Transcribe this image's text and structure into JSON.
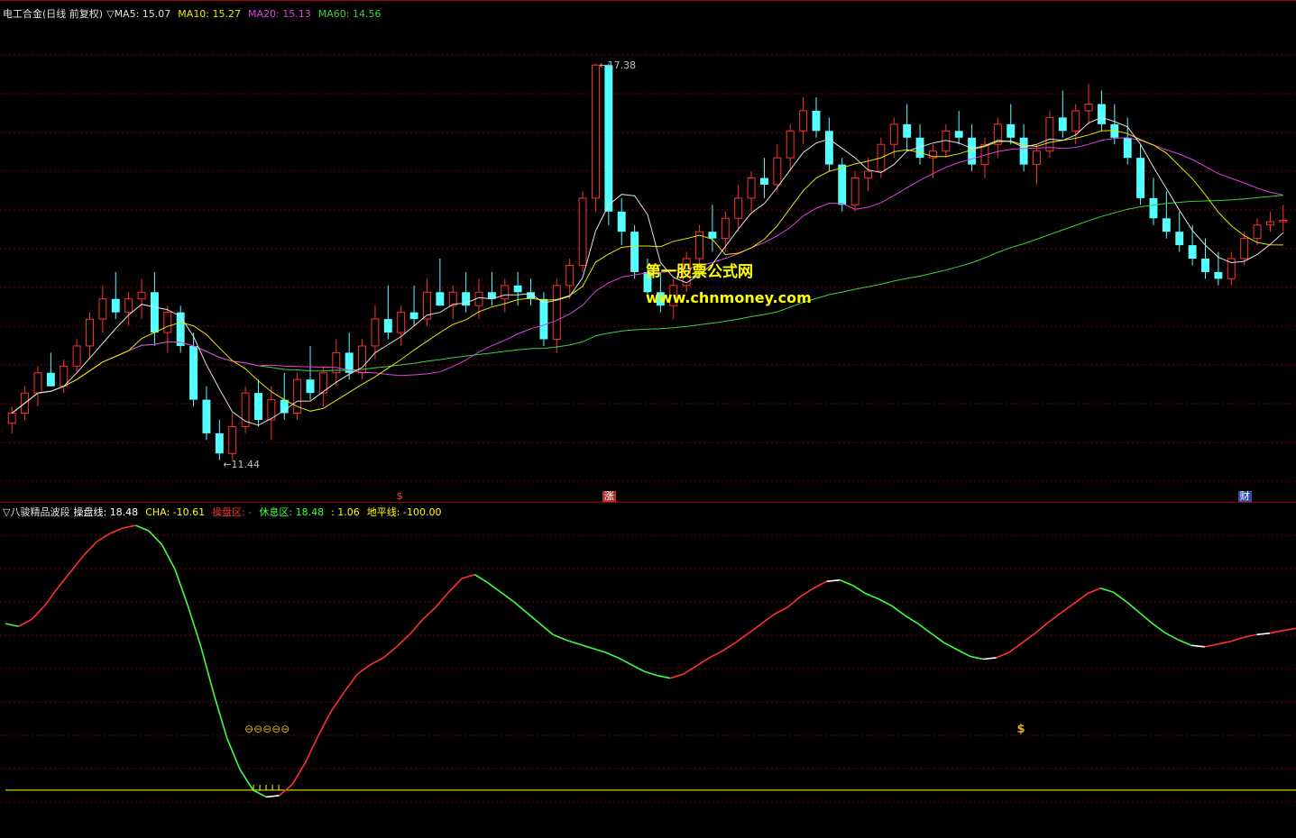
{
  "upper_header": {
    "stock_label": "电工合金(日线 前复权)",
    "indicator_mark": "▽",
    "ma5": {
      "label": "MA5:",
      "value": "15.07",
      "color": "#e0e0e0"
    },
    "ma10": {
      "label": "MA10:",
      "value": "15.27",
      "color": "#e6e600"
    },
    "ma20": {
      "label": "MA20:",
      "value": "15.13",
      "color": "#e040e0"
    },
    "ma60": {
      "label": "MA60:",
      "value": "14.56",
      "color": "#40d040"
    }
  },
  "watermark": {
    "line1": "第一股票公式网",
    "line2": "www.chnmoney.com"
  },
  "price_labels": {
    "high": "17.38",
    "low": "11.44"
  },
  "event_markers": [
    {
      "text": "$",
      "color": "#ff4040",
      "bg": "#000000"
    },
    {
      "text": "涨",
      "color": "#ffffff",
      "bg": "#b03030"
    },
    {
      "text": "财",
      "color": "#ffffff",
      "bg": "#3050b0"
    }
  ],
  "lower_header": {
    "indicator_name": "▽八骏精品波段",
    "line1": {
      "label": "操盘线:",
      "value": "18.48",
      "color": "#ffffff"
    },
    "line2": {
      "label": "CHA:",
      "value": "-10.61",
      "color": "#ffff00"
    },
    "line3": {
      "label": "操盘区:",
      "value": "-",
      "color": "#ff3030"
    },
    "line4": {
      "label": "休息区:",
      "value": "18.48",
      "color": "#40ff40"
    },
    "line5": {
      "label": ":",
      "value": "1.06",
      "color": "#ffff00"
    },
    "line6": {
      "label": "地平线:",
      "value": "-100.00",
      "color": "#ffff00"
    }
  },
  "colors": {
    "up": "#ff3030",
    "down": "#54ffff",
    "ma5": "#e0e0e0",
    "ma10": "#e6e600",
    "ma20": "#e040e0",
    "ma60": "#40d040",
    "grid": "#7a0000",
    "border": "#a00000"
  },
  "chart_data": [
    {
      "type": "candlestick",
      "title": "电工合金(日线 前复权)",
      "ylim": [
        11.0,
        18.0
      ],
      "ohlc": [
        [
          12.05,
          12.3,
          11.9,
          12.2
        ],
        [
          12.2,
          12.6,
          12.1,
          12.5
        ],
        [
          12.5,
          12.9,
          12.3,
          12.8
        ],
        [
          12.8,
          13.1,
          12.6,
          12.6
        ],
        [
          12.6,
          13.0,
          12.5,
          12.9
        ],
        [
          12.9,
          13.3,
          12.8,
          13.2
        ],
        [
          13.2,
          13.7,
          13.0,
          13.6
        ],
        [
          13.6,
          14.1,
          13.4,
          13.9
        ],
        [
          13.9,
          14.3,
          13.6,
          13.7
        ],
        [
          13.7,
          14.0,
          13.5,
          13.9
        ],
        [
          13.9,
          14.2,
          13.6,
          14.0
        ],
        [
          14.0,
          14.3,
          13.2,
          13.4
        ],
        [
          13.4,
          13.8,
          13.1,
          13.7
        ],
        [
          13.7,
          13.8,
          13.1,
          13.2
        ],
        [
          13.2,
          13.4,
          12.3,
          12.4
        ],
        [
          12.4,
          12.6,
          11.8,
          11.9
        ],
        [
          11.9,
          12.1,
          11.5,
          11.6
        ],
        [
          11.6,
          12.2,
          11.5,
          12.0
        ],
        [
          12.0,
          12.6,
          11.9,
          12.5
        ],
        [
          12.5,
          12.7,
          12.0,
          12.1
        ],
        [
          12.1,
          12.6,
          11.8,
          12.4
        ],
        [
          12.4,
          12.8,
          12.1,
          12.2
        ],
        [
          12.2,
          12.8,
          12.1,
          12.7
        ],
        [
          12.7,
          13.2,
          12.4,
          12.5
        ],
        [
          12.5,
          12.9,
          12.3,
          12.8
        ],
        [
          12.8,
          13.3,
          12.6,
          13.1
        ],
        [
          13.1,
          13.4,
          12.7,
          12.8
        ],
        [
          12.8,
          13.3,
          12.7,
          13.2
        ],
        [
          13.2,
          13.8,
          13.0,
          13.6
        ],
        [
          13.6,
          14.1,
          13.3,
          13.4
        ],
        [
          13.4,
          13.8,
          13.2,
          13.7
        ],
        [
          13.7,
          14.1,
          13.5,
          13.6
        ],
        [
          13.6,
          14.2,
          13.5,
          14.0
        ],
        [
          14.0,
          14.5,
          13.8,
          13.8
        ],
        [
          13.8,
          14.1,
          13.6,
          14.0
        ],
        [
          14.0,
          14.3,
          13.7,
          13.8
        ],
        [
          13.8,
          14.2,
          13.6,
          14.0
        ],
        [
          14.0,
          14.3,
          13.8,
          13.9
        ],
        [
          13.9,
          14.2,
          13.7,
          14.1
        ],
        [
          14.1,
          14.3,
          13.8,
          14.0
        ],
        [
          14.0,
          14.2,
          13.8,
          13.9
        ],
        [
          13.9,
          14.0,
          13.2,
          13.3
        ],
        [
          13.3,
          14.2,
          13.1,
          14.1
        ],
        [
          14.1,
          14.5,
          13.9,
          14.4
        ],
        [
          14.4,
          15.5,
          14.3,
          15.4
        ],
        [
          15.4,
          17.4,
          15.2,
          17.38
        ],
        [
          17.38,
          17.4,
          15.0,
          15.2
        ],
        [
          15.2,
          15.4,
          14.7,
          14.9
        ],
        [
          14.9,
          15.0,
          14.2,
          14.3
        ],
        [
          14.3,
          14.5,
          13.9,
          14.0
        ],
        [
          14.0,
          14.3,
          13.7,
          13.8
        ],
        [
          13.8,
          14.2,
          13.6,
          14.1
        ],
        [
          14.1,
          14.6,
          14.0,
          14.5
        ],
        [
          14.5,
          15.0,
          14.3,
          14.9
        ],
        [
          14.9,
          15.3,
          14.6,
          14.8
        ],
        [
          14.8,
          15.2,
          14.6,
          15.1
        ],
        [
          15.1,
          15.6,
          14.9,
          15.4
        ],
        [
          15.4,
          15.8,
          15.2,
          15.7
        ],
        [
          15.7,
          16.0,
          15.4,
          15.6
        ],
        [
          15.6,
          16.2,
          15.5,
          16.0
        ],
        [
          16.0,
          16.5,
          15.8,
          16.4
        ],
        [
          16.4,
          16.9,
          16.2,
          16.7
        ],
        [
          16.7,
          16.9,
          16.3,
          16.4
        ],
        [
          16.4,
          16.6,
          15.8,
          15.9
        ],
        [
          15.9,
          16.0,
          15.2,
          15.3
        ],
        [
          15.3,
          15.8,
          15.2,
          15.7
        ],
        [
          15.7,
          16.0,
          15.5,
          15.8
        ],
        [
          15.8,
          16.3,
          15.7,
          16.2
        ],
        [
          16.2,
          16.6,
          16.0,
          16.5
        ],
        [
          16.5,
          16.8,
          16.1,
          16.3
        ],
        [
          16.3,
          16.5,
          15.9,
          16.0
        ],
        [
          16.0,
          16.2,
          15.7,
          16.1
        ],
        [
          16.1,
          16.5,
          16.0,
          16.4
        ],
        [
          16.4,
          16.7,
          16.2,
          16.3
        ],
        [
          16.3,
          16.5,
          15.8,
          15.9
        ],
        [
          15.9,
          16.3,
          15.7,
          16.2
        ],
        [
          16.2,
          16.6,
          16.0,
          16.5
        ],
        [
          16.5,
          16.8,
          16.2,
          16.3
        ],
        [
          16.3,
          16.5,
          15.8,
          15.9
        ],
        [
          15.9,
          16.2,
          15.6,
          16.1
        ],
        [
          16.1,
          16.7,
          16.0,
          16.6
        ],
        [
          16.6,
          17.0,
          16.3,
          16.4
        ],
        [
          16.4,
          16.8,
          16.2,
          16.7
        ],
        [
          16.7,
          17.1,
          16.5,
          16.8
        ],
        [
          16.8,
          17.0,
          16.4,
          16.5
        ],
        [
          16.5,
          16.8,
          16.2,
          16.3
        ],
        [
          16.3,
          16.6,
          15.9,
          16.0
        ],
        [
          16.0,
          16.2,
          15.3,
          15.4
        ],
        [
          15.4,
          15.7,
          15.0,
          15.1
        ],
        [
          15.1,
          15.5,
          14.8,
          14.9
        ],
        [
          14.9,
          15.2,
          14.6,
          14.7
        ],
        [
          14.7,
          15.0,
          14.4,
          14.5
        ],
        [
          14.5,
          14.8,
          14.2,
          14.3
        ],
        [
          14.3,
          14.6,
          14.1,
          14.2
        ],
        [
          14.2,
          14.6,
          14.1,
          14.5
        ],
        [
          14.5,
          14.9,
          14.4,
          14.8
        ],
        [
          14.8,
          15.1,
          14.7,
          15.0
        ],
        [
          15.0,
          15.2,
          14.9,
          15.05
        ],
        [
          15.05,
          15.3,
          14.9,
          15.07
        ]
      ]
    },
    {
      "type": "line",
      "title": "八骏精品波段",
      "ylim": [
        -110,
        100
      ],
      "horizon": -100.0,
      "values": [
        22,
        20,
        25,
        35,
        48,
        60,
        72,
        82,
        88,
        92,
        94,
        90,
        80,
        62,
        35,
        5,
        -30,
        -62,
        -85,
        -100,
        -105,
        -104,
        -96,
        -80,
        -60,
        -42,
        -28,
        -15,
        -8,
        -3,
        5,
        14,
        25,
        34,
        45,
        55,
        58,
        52,
        45,
        38,
        30,
        22,
        14,
        10,
        7,
        4,
        1,
        -3,
        -8,
        -13,
        -16,
        -18,
        -15,
        -9,
        -3,
        2,
        8,
        15,
        22,
        29,
        34,
        42,
        48,
        53,
        54,
        50,
        44,
        40,
        35,
        28,
        22,
        15,
        8,
        3,
        -2,
        -4,
        -3,
        1,
        8,
        15,
        23,
        30,
        37,
        44,
        48,
        45,
        38,
        30,
        22,
        15,
        10,
        6,
        5,
        7,
        9,
        12,
        14,
        15,
        17,
        18.48
      ],
      "down_marker": "⊖⊖⊖⊖⊖",
      "up_marker": "$"
    }
  ]
}
